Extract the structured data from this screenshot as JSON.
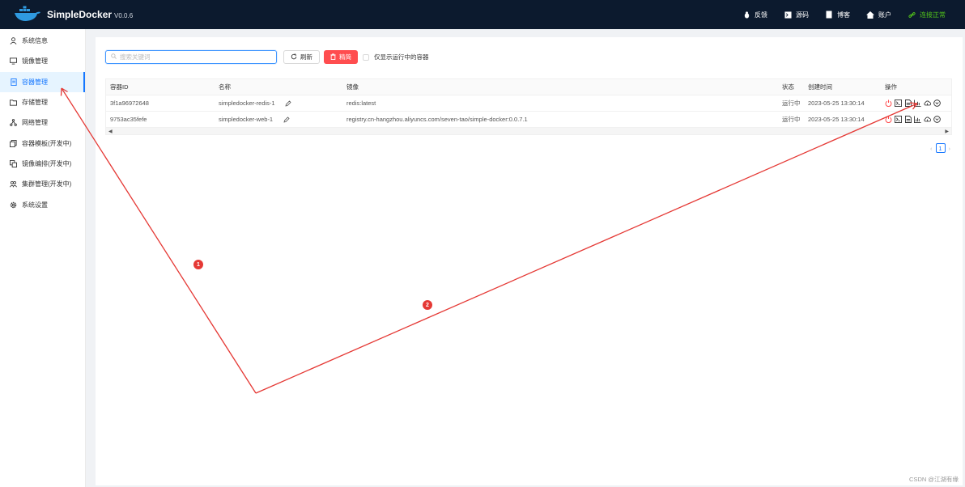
{
  "header": {
    "brand": "SimpleDocker",
    "version": "V0.0.6",
    "nav": [
      {
        "label": "反馈",
        "icon": "bug-icon"
      },
      {
        "label": "源码",
        "icon": "terminal-icon"
      },
      {
        "label": "博客",
        "icon": "document-icon"
      },
      {
        "label": "账户",
        "icon": "home-icon"
      },
      {
        "label": "连接正常",
        "icon": "link-icon"
      }
    ],
    "status_color": "#52c41a"
  },
  "sidebar": {
    "items": [
      {
        "label": "系统信息",
        "icon": "user-icon"
      },
      {
        "label": "镜像管理",
        "icon": "monitor-icon"
      },
      {
        "label": "容器管理",
        "icon": "file-icon",
        "active": true
      },
      {
        "label": "存储管理",
        "icon": "folder-icon"
      },
      {
        "label": "网络管理",
        "icon": "network-icon"
      },
      {
        "label": "容器模板(开发中)",
        "icon": "copy-icon"
      },
      {
        "label": "镜像编排(开发中)",
        "icon": "layers-icon"
      },
      {
        "label": "集群管理(开发中)",
        "icon": "team-icon"
      },
      {
        "label": "系统设置",
        "icon": "gear-icon"
      }
    ],
    "accent": "#1677ff"
  },
  "toolbar": {
    "search_placeholder": "搜索关键词",
    "refresh_label": "刷新",
    "clean_label": "精简",
    "only_running_label": "仅显示运行中的容器"
  },
  "table": {
    "headers": [
      "容器ID",
      "名称",
      "镜像",
      "状态",
      "创建时间",
      "操作"
    ],
    "rows": [
      {
        "id": "3f1a96972648",
        "name": "simpledocker-redis-1",
        "image": "redis:latest",
        "status": "运行中",
        "created": "2023-05-25 13:30:14"
      },
      {
        "id": "9753ac35fefe",
        "name": "simpledocker-web-1",
        "image": "registry.cn-hangzhou.aliyuncs.com/seven-tao/simple-docker:0.0.7.1",
        "status": "运行中",
        "created": "2023-05-25 13:30:14"
      }
    ],
    "row_actions": [
      "power-icon",
      "terminal-icon",
      "file-text-icon",
      "stats-icon",
      "cloud-icon",
      "more-icon"
    ]
  },
  "pagination": {
    "current": "1"
  },
  "annotations": [
    {
      "label": "1"
    },
    {
      "label": "2"
    }
  ],
  "annotation_color": "#e53935",
  "watermark": "CSDN @江湖有缘"
}
